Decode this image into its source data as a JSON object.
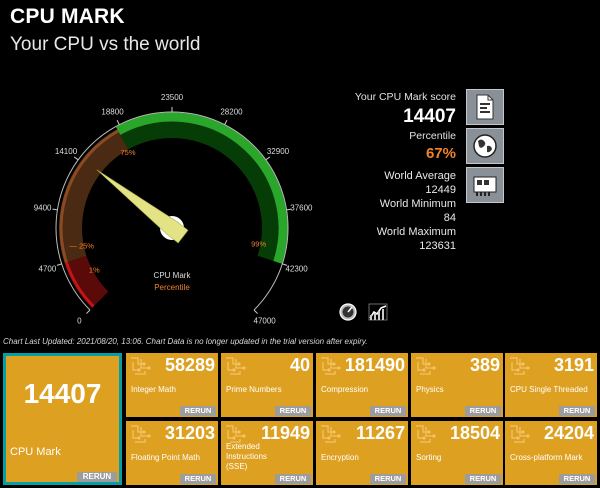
{
  "header": {
    "title": "CPU MARK",
    "subtitle": "Your CPU vs the world"
  },
  "gauge": {
    "ticks": [
      "0",
      "4700",
      "9400",
      "14100",
      "18800",
      "23500",
      "28200",
      "32900",
      "37600",
      "42300",
      "47000"
    ],
    "band_labels": [
      "1%",
      "25%",
      "75%",
      "99%"
    ],
    "center_label": "CPU Mark",
    "center_sublabel": "Percentile",
    "max": 47000,
    "needle_value": 14407,
    "colors": {
      "red": "#5b0a0a",
      "brown": "#4a2a12",
      "green": "#063d06",
      "needle": "#e3e385",
      "band_text": "#f0822a"
    }
  },
  "stats": {
    "score_label": "Your CPU Mark score",
    "score": "14407",
    "percentile_label": "Percentile",
    "percentile": "67%",
    "avg_label": "World Average",
    "avg": "12449",
    "min_label": "World Minimum",
    "min": "84",
    "max_label": "World Maximum",
    "max": "123631"
  },
  "side_buttons": [
    "document-icon",
    "globe-icon",
    "hardware-card-icon"
  ],
  "tool_icons": [
    "speedometer-icon",
    "chart-icon"
  ],
  "footnote": "Chart Last Updated: 2021/08/20, 13:06. Chart Data is no longer updated in the trial version after expiry.",
  "main_tile": {
    "score": "14407",
    "label": "CPU Mark",
    "rerun": "RERUN"
  },
  "tiles": [
    {
      "value": "58289",
      "label": "Integer Math",
      "rerun": "RERUN"
    },
    {
      "value": "40",
      "label": "Prime Numbers",
      "rerun": "RERUN"
    },
    {
      "value": "181490",
      "label": "Compression",
      "rerun": "RERUN"
    },
    {
      "value": "389",
      "label": "Physics",
      "rerun": "RERUN"
    },
    {
      "value": "3191",
      "label": "CPU Single Threaded",
      "rerun": "RERUN"
    },
    {
      "value": "31203",
      "label": "Floating Point Math",
      "rerun": "RERUN"
    },
    {
      "value": "11949",
      "label": "Extended Instructions (SSE)",
      "rerun": "RERUN"
    },
    {
      "value": "11267",
      "label": "Encryption",
      "rerun": "RERUN"
    },
    {
      "value": "18504",
      "label": "Sorting",
      "rerun": "RERUN"
    },
    {
      "value": "24204",
      "label": "Cross-platform Mark",
      "rerun": "RERUN"
    }
  ]
}
